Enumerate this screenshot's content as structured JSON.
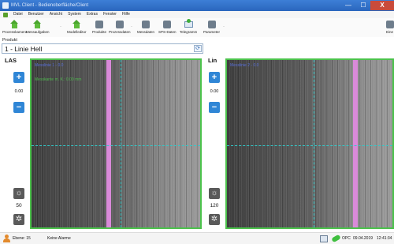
{
  "window": {
    "title": "MVL Client - Bedienoberfläche/Client",
    "min": "—",
    "max": "☐",
    "close": "X"
  },
  "menu": [
    "Datei",
    "Benutzer",
    "Ansicht",
    "System",
    "Extras",
    "Fenster",
    "Hilfe"
  ],
  "toolbar": {
    "items": [
      {
        "label": "Prozesskamera",
        "icon": "house-icon"
      },
      {
        "label": "Messaufgaben",
        "icon": "house-icon"
      },
      {
        "label": "Modelleditor",
        "icon": "house-icon"
      },
      {
        "label": "Produkte",
        "icon": "gear-icon"
      },
      {
        "label": "Prozessdaten",
        "icon": "gear-icon"
      },
      {
        "label": "Messdaten",
        "icon": "gear-icon"
      },
      {
        "label": "SPS-Daten",
        "icon": "gear-icon"
      },
      {
        "label": "Telegramm",
        "icon": "envelope-icon"
      },
      {
        "label": "Parameter",
        "icon": "gear-icon"
      },
      {
        "label": "Eine",
        "icon": "gear-icon"
      }
    ]
  },
  "product": {
    "label": "Produkt",
    "value": "1 - Linie Hell",
    "refresh_icon": "refresh-icon"
  },
  "cameras": [
    {
      "name": "LAS",
      "offset_value": "0.00",
      "brightness": "50",
      "overlay_line1": "Messlinie 1 - 0.0",
      "overlay_line2": "Messkante m. K.: 0.00 mm"
    },
    {
      "name": "Lin",
      "offset_value": "0.00",
      "brightness": "120",
      "overlay_line1": "Messlinie 2 - 0.0",
      "overlay_line2": ""
    }
  ],
  "status": {
    "user": "Ebene: 15",
    "alarms": "Keine Alarme",
    "opc": "OPC",
    "date": "09.04.2019",
    "time": "12:41:34"
  },
  "colors": {
    "frame_border": "#4cc24c",
    "marker": "#d98ad9",
    "guide": "#32c9c9",
    "accent_button": "#2f86d6"
  }
}
